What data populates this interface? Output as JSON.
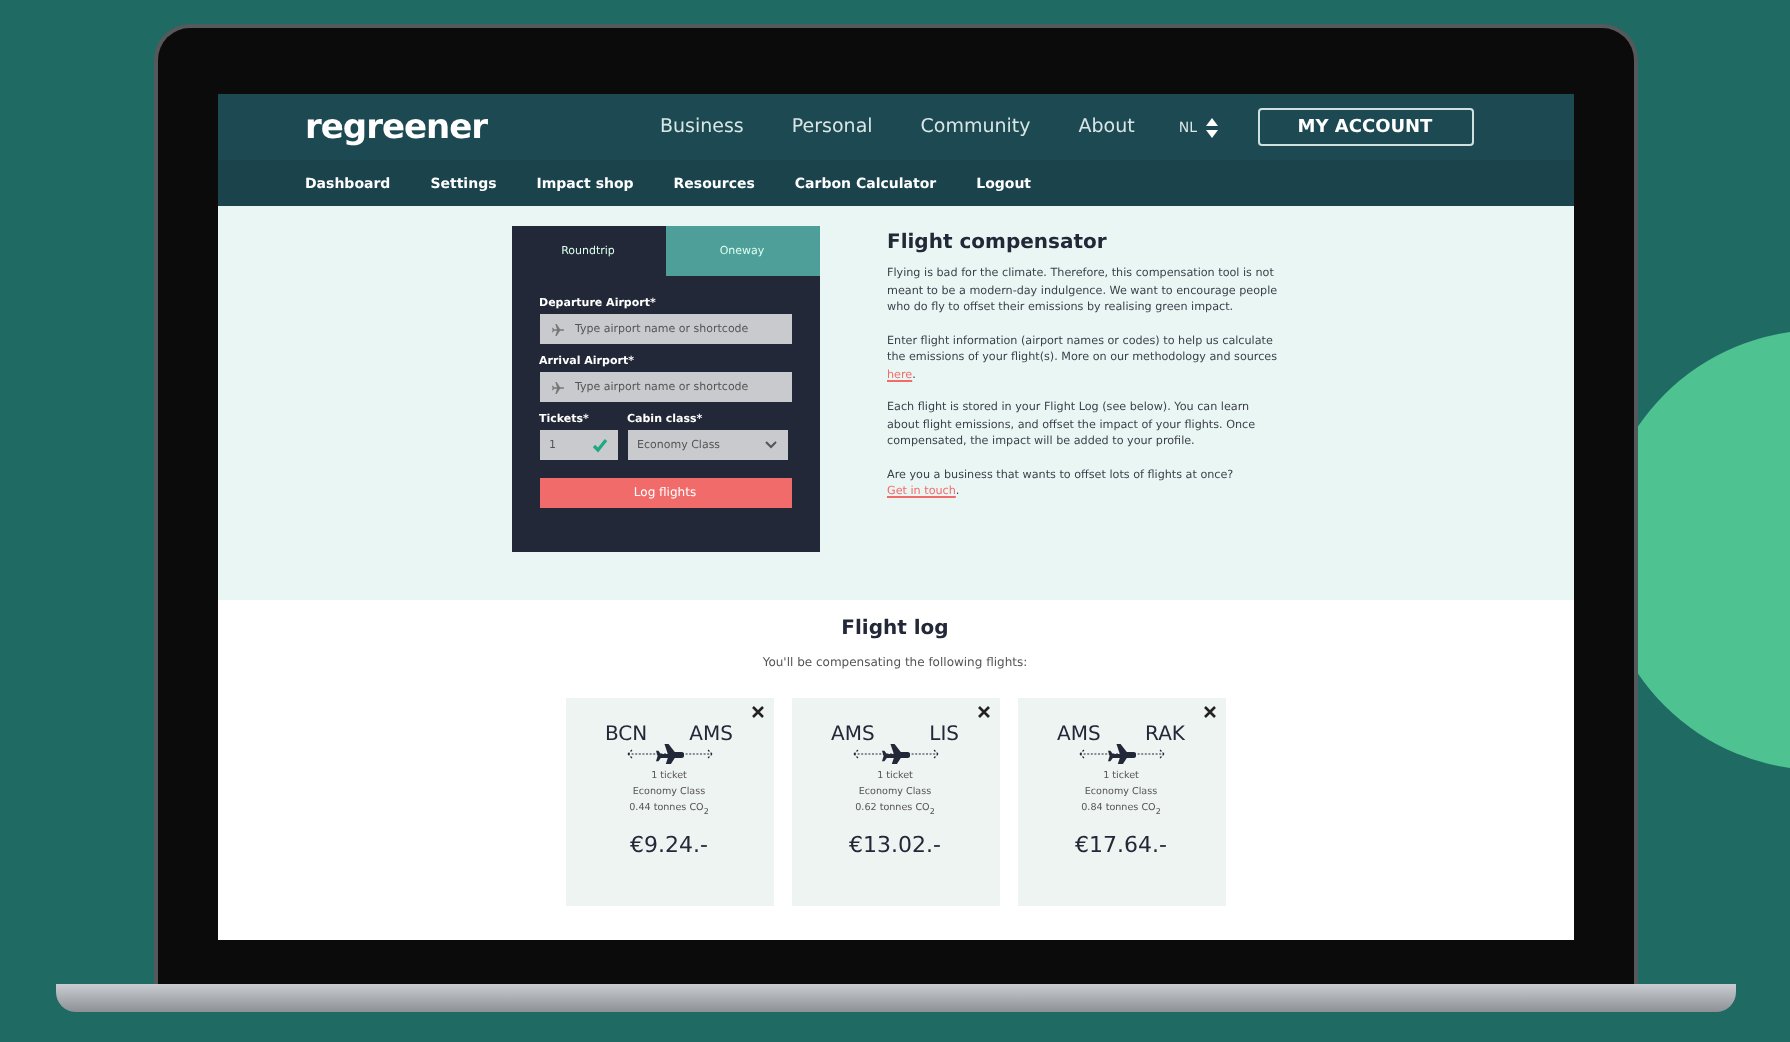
{
  "header": {
    "logo": "regreener",
    "nav": [
      "Business",
      "Personal",
      "Community",
      "About"
    ],
    "language": "NL",
    "account_button": "MY ACCOUNT"
  },
  "subnav": [
    "Dashboard",
    "Settings",
    "Impact shop",
    "Resources",
    "Carbon Calculator",
    "Logout"
  ],
  "form": {
    "tabs": [
      {
        "label": "Roundtrip",
        "selected": true
      },
      {
        "label": "Oneway",
        "selected": false
      }
    ],
    "fields": [
      {
        "label": "Departure Airport*",
        "placeholder": "Type airport name or shortcode"
      },
      {
        "label": "Arrival Airport*",
        "placeholder": "Type airport name or shortcode"
      }
    ],
    "tickets": {
      "label": "Tickets*",
      "value": "1",
      "valid": true
    },
    "cabin": {
      "label": "Cabin class*",
      "value": "Economy Class"
    },
    "submit": "Log flights"
  },
  "info": {
    "title": "Flight compensator",
    "paragraphs": [
      [
        {
          "text": "Flying is bad for the climate. Therefore, this compensation tool is not meant to be a modern-day indulgence. We want to encourage people who do fly to offset their emissions by realising green impact."
        }
      ],
      [
        {
          "text": "Enter flight information (airport names or codes) to help us calculate the emissions of your flight(s). More on our methodology and sources "
        },
        {
          "link": "here"
        },
        {
          "text": "."
        }
      ],
      [
        {
          "text": "Each flight is stored in your Flight Log (see below). You can learn about flight emissions, and offset the impact of your flights. Once compensated, the impact will be added to your profile."
        }
      ],
      [
        {
          "text": "Are you a business that wants to offset lots of flights at once? "
        },
        {
          "link": "Get in touch"
        },
        {
          "text": "."
        }
      ]
    ]
  },
  "flight_log": {
    "title": "Flight log",
    "subtitle": "You'll be compensating the following flights:",
    "flights": [
      {
        "from": "BCN",
        "to": "AMS",
        "tickets": "1 ticket",
        "cabin": "Economy Class",
        "emissions": "0.44 tonnes CO$_{2}$",
        "price": "€9.24.-"
      },
      {
        "from": "AMS",
        "to": "LIS",
        "tickets": "1 ticket",
        "cabin": "Economy Class",
        "emissions": "0.62 tonnes CO$_{2}$",
        "price": "€13.02.-"
      },
      {
        "from": "AMS",
        "to": "RAK",
        "tickets": "1 ticket",
        "cabin": "Economy Class",
        "emissions": "0.84 tonnes CO$_{2}$",
        "price": "€17.64.-"
      }
    ]
  }
}
